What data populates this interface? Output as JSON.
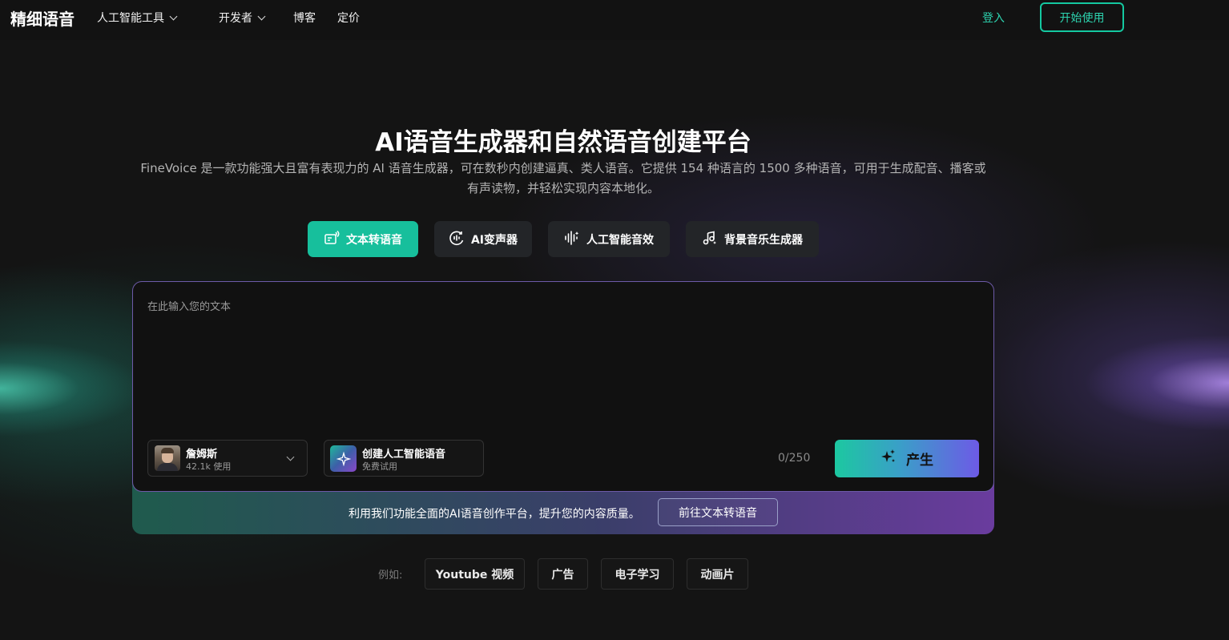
{
  "nav": {
    "logo": "精细语音",
    "items": [
      {
        "label": "人工智能工具",
        "has_dropdown": true
      },
      {
        "label": "开发者",
        "has_dropdown": true
      },
      {
        "label": "博客",
        "has_dropdown": false
      },
      {
        "label": "定价",
        "has_dropdown": false
      }
    ],
    "login": "登入",
    "start": "开始使用"
  },
  "hero": {
    "title": "AI语音生成器和自然语音创建平台",
    "description": "FineVoice 是一款功能强大且富有表现力的 AI 语音生成器，可在数秒内创建逼真、类人语音。它提供 154 种语言的 1500 多种语音，可用于生成配音、播客或有声读物，并轻松实现内容本地化。"
  },
  "tabs": [
    {
      "label": "文本转语音",
      "icon": "text-to-speech-icon",
      "active": true
    },
    {
      "label": "AI变声器",
      "icon": "voice-changer-icon",
      "active": false
    },
    {
      "label": "人工智能音效",
      "icon": "sound-wave-icon",
      "active": false
    },
    {
      "label": "背景音乐生成器",
      "icon": "music-note-icon",
      "active": false
    }
  ],
  "editor": {
    "placeholder": "在此输入您的文本",
    "voice": {
      "name": "詹姆斯",
      "usage": "42.1k 使用"
    },
    "create_voice": {
      "title": "创建人工智能语音",
      "subtitle": "免费试用"
    },
    "char_count": "0/250",
    "generate": "产生"
  },
  "banner": {
    "text": "利用我们功能全面的AI语音创作平台，提升您的内容质量。",
    "button": "前往文本转语音"
  },
  "examples": {
    "label": "例如:",
    "chips": [
      "Youtube 视频",
      "广告",
      "电子学习",
      "动画片"
    ]
  },
  "colors": {
    "accent": "#17bf9c",
    "background": "#141414",
    "purple": "#6d5ae6"
  }
}
